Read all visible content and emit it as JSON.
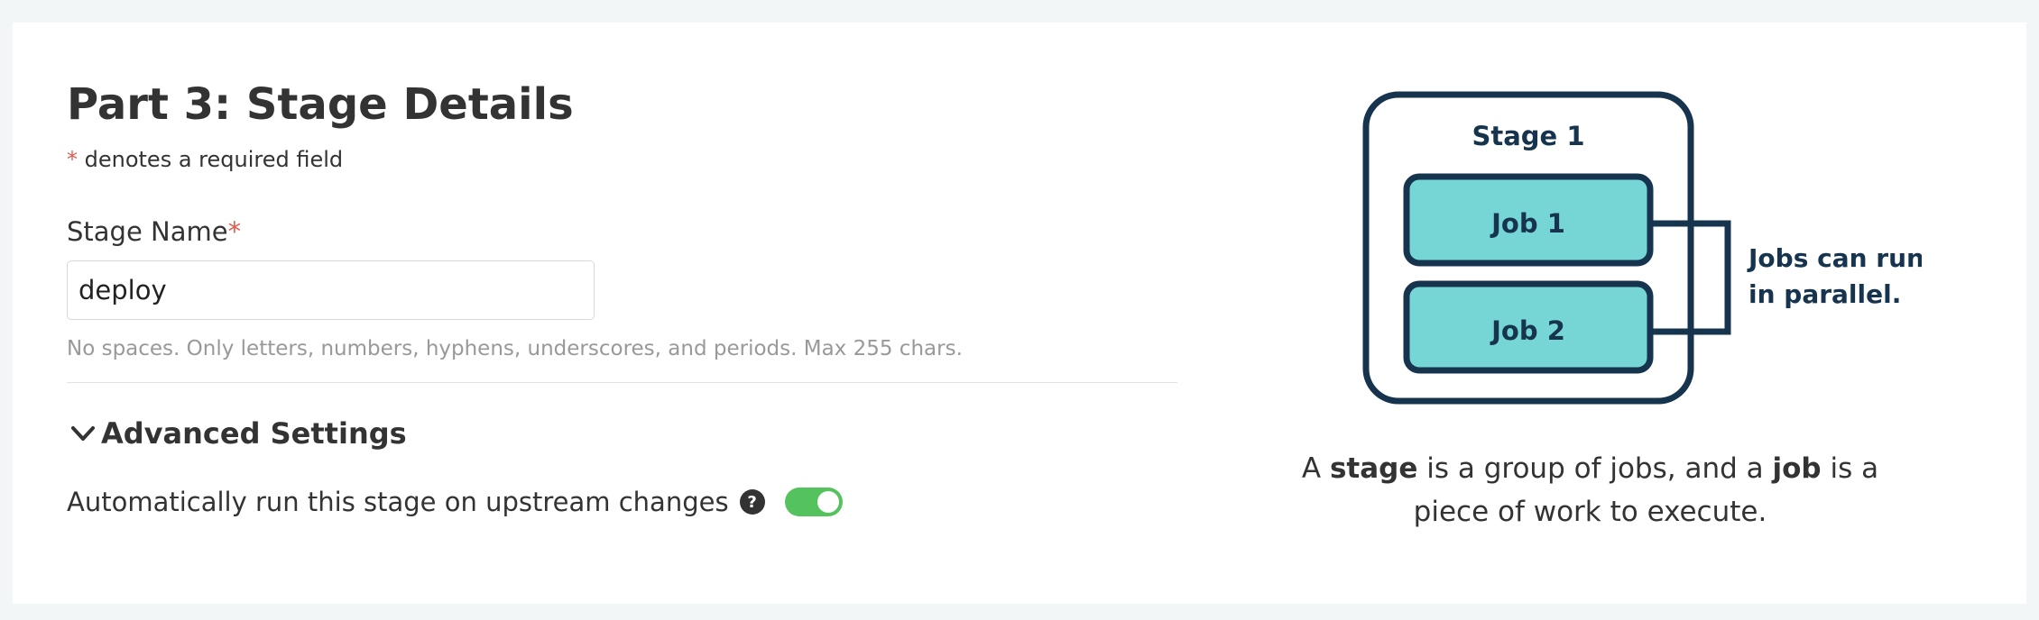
{
  "form": {
    "title": "Part 3: Stage Details",
    "required_star": "*",
    "required_note": " denotes a required field",
    "stage_name_label": "Stage Name",
    "stage_name_value": "deploy",
    "stage_name_hint": "No spaces. Only letters, numbers, hyphens, underscores, and periods. Max 255 chars.",
    "advanced_settings_label": "Advanced Settings",
    "advanced_expanded": true,
    "auto_run_label": "Automatically run this stage on upstream changes",
    "help_glyph": "?",
    "auto_run_enabled": true
  },
  "illustration": {
    "stage_label": "Stage 1",
    "jobs": [
      "Job 1",
      "Job 2"
    ],
    "parallel_note_line1": "Jobs can run",
    "parallel_note_line2": "in parallel.",
    "caption": {
      "part1": "A ",
      "term_stage": "stage",
      "part2": " is a group of jobs, and a ",
      "term_job": "job",
      "part3": " is a piece of work to execute."
    }
  },
  "colors": {
    "required_star": "#e05a50",
    "toggle_on": "#55c35d",
    "diagram_stroke": "#17344f",
    "job_fill": "#76d6d6"
  }
}
